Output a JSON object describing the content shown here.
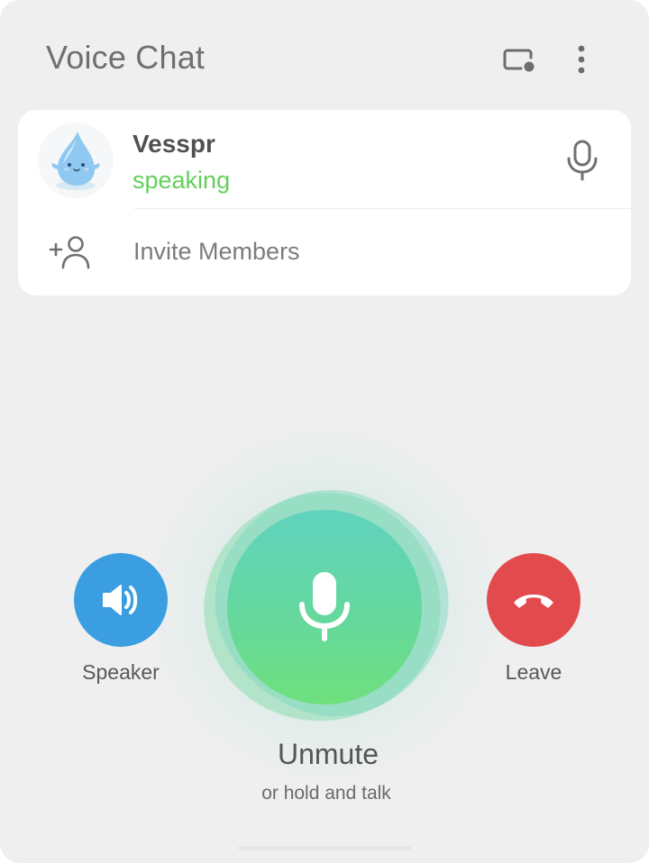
{
  "header": {
    "title": "Voice Chat",
    "screen_share_icon": "screen-share-icon",
    "more_icon": "more-vertical-icon"
  },
  "participants": [
    {
      "name": "Vesspr",
      "status": "speaking",
      "avatar_icon": "water-drop-mascot-avatar",
      "mic_icon": "microphone-icon"
    }
  ],
  "invite": {
    "label": "Invite Members",
    "icon": "add-person-icon"
  },
  "controls": {
    "speaker_label": "Speaker",
    "leave_label": "Leave",
    "unmute_label": "Unmute",
    "unmute_hint": "or hold and talk"
  },
  "colors": {
    "speaking": "#62d05a",
    "speaker_button": "#3b9ee0",
    "leave_button": "#e24a4e",
    "unmute_top": "#60d3bf",
    "unmute_bottom": "#6ee07d",
    "sheet_background": "#efefef"
  }
}
